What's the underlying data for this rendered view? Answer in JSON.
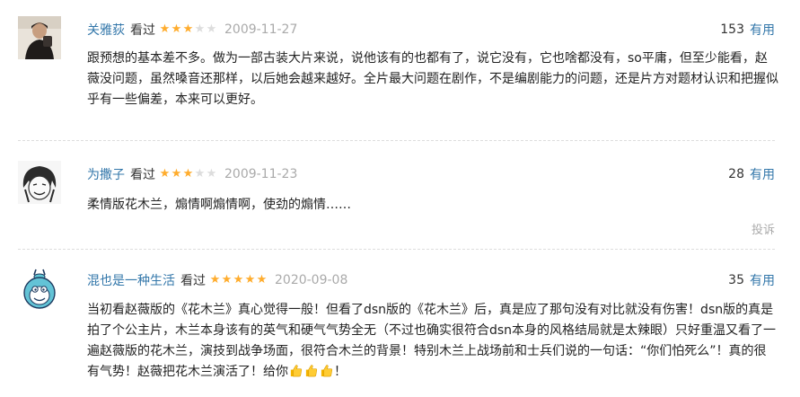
{
  "comments": [
    {
      "user": "关雅荻",
      "action": "看过",
      "rating": 3,
      "date": "2009-11-27",
      "votes": "153",
      "vote_label": "有用",
      "text": "跟预想的基本差不多。做为一部古装大片来说，说他该有的也都有了，说它没有，它也啥都没有，so平庸，但至少能看，赵薇没问题，虽然嗓音还那样，以后她会越来越好。全片最大问题在剧作，不是编剧能力的问题，还是片方对题材认识和把握似乎有一些偏差，本来可以更好。"
    },
    {
      "user": "为撒子",
      "action": "看过",
      "rating": 3,
      "date": "2009-11-23",
      "votes": "28",
      "vote_label": "有用",
      "text": "柔情版花木兰，煽情啊煽情啊，使劲的煽情……",
      "report": "投诉"
    },
    {
      "user": "混也是一种生活",
      "action": "看过",
      "rating": 5,
      "date": "2020-09-08",
      "votes": "35",
      "vote_label": "有用",
      "text": "当初看赵薇版的《花木兰》真心觉得一般！但看了dsn版的《花木兰》后，真是应了那句没有对比就没有伤害！dsn版的真是拍了个公主片，木兰本身该有的英气和硬气气势全无（不过也确实很符合dsn本身的风格结局就是太辣眼）只好重温又看了一遍赵薇版的花木兰，演技到战争场面，很符合木兰的背景！特别木兰上战场前和士兵们说的一句话：“你们怕死么”！真的很有气势！赵薇把花木兰演活了！给你",
      "text_tail": "！",
      "thumb_icon": "thumbs-up-emoji"
    }
  ],
  "colors": {
    "link": "#3377aa",
    "star_on": "#ffac2d",
    "star_off": "#dddddd",
    "muted": "#aaaaaa"
  }
}
